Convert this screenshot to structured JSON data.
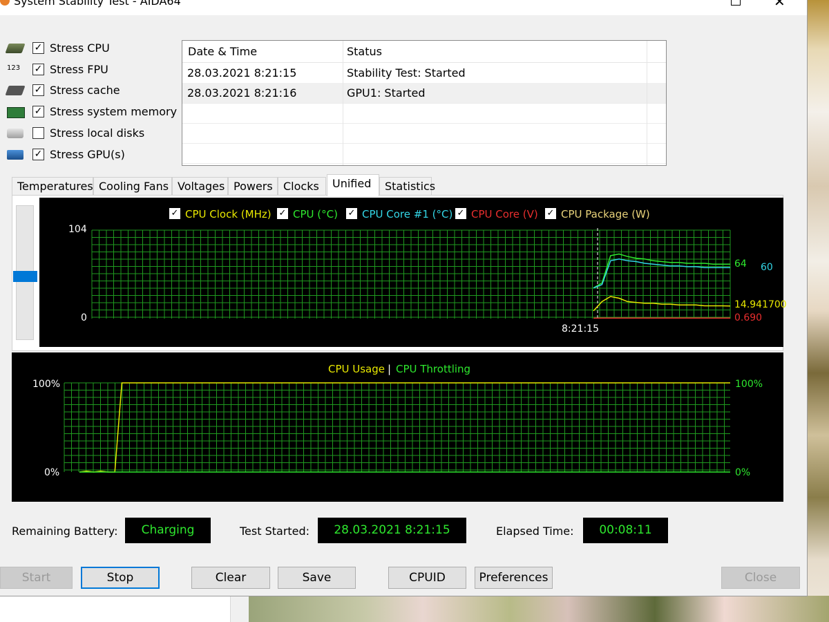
{
  "window": {
    "title": "System Stability Test - AIDA64"
  },
  "stress_options": [
    {
      "label": "Stress CPU",
      "checked": true,
      "icon": "cpu-chip-icon"
    },
    {
      "label": "Stress FPU",
      "checked": true,
      "icon": "fpu-123-icon"
    },
    {
      "label": "Stress cache",
      "checked": true,
      "icon": "cache-chip-icon"
    },
    {
      "label": "Stress system memory",
      "checked": true,
      "icon": "memory-module-icon"
    },
    {
      "label": "Stress local disks",
      "checked": false,
      "icon": "disk-drive-icon"
    },
    {
      "label": "Stress GPU(s)",
      "checked": true,
      "icon": "gpu-card-icon"
    }
  ],
  "checkmark": "✓",
  "log": {
    "headers": [
      "Date & Time",
      "Status"
    ],
    "rows": [
      [
        "28.03.2021 8:21:15",
        "Stability Test: Started"
      ],
      [
        "28.03.2021 8:21:16",
        "GPU1: Started"
      ]
    ]
  },
  "tabs": [
    "Temperatures",
    "Cooling Fans",
    "Voltages",
    "Powers",
    "Clocks",
    "Unified",
    "Statistics"
  ],
  "active_tab": "Unified",
  "slider": {
    "value_fraction": 0.53
  },
  "graph_top": {
    "legend": [
      {
        "label": "CPU Clock (MHz)",
        "color": "#e8e800"
      },
      {
        "label": "CPU (°C)",
        "color": "#2ee82e"
      },
      {
        "label": "CPU Core #1 (°C)",
        "color": "#33d6e6"
      },
      {
        "label": "CPU Core (V)",
        "color": "#e82e2e"
      },
      {
        "label": "CPU Package (W)",
        "color": "#e8d27a"
      }
    ],
    "y_max_label": "104",
    "y_min_label": "0",
    "x_label": "8:21:15",
    "right_values": [
      {
        "text": "64",
        "color": "#2ee82e"
      },
      {
        "text": "60",
        "color": "#33d6e6"
      },
      {
        "text": "14.941700",
        "color": "#e8e800"
      },
      {
        "text": "0.690",
        "color": "#e82e2e"
      }
    ]
  },
  "graph_bottom": {
    "legend": [
      {
        "label": "CPU Usage",
        "color": "#e8e800"
      },
      {
        "label": "|",
        "color": "#ffffff"
      },
      {
        "label": "CPU Throttling",
        "color": "#2ee82e"
      }
    ],
    "y_left_max": "100%",
    "y_left_min": "0%",
    "y_right_max": "100%",
    "y_right_min": "0%"
  },
  "chart_data": [
    {
      "type": "line",
      "legend": [
        "CPU Clock (MHz)",
        "CPU (°C)",
        "CPU Core #1 (°C)",
        "CPU Core (V)",
        "CPU Package (W)"
      ],
      "ylim": [
        0,
        104
      ],
      "x_tick_labels": [
        "8:21:15"
      ],
      "series": [
        {
          "name": "CPU (°C)",
          "color": "#2ee82e",
          "values": [
            36,
            42,
            74,
            76,
            73,
            71,
            70,
            68,
            67,
            66,
            66,
            65,
            65,
            65,
            64,
            64,
            64
          ]
        },
        {
          "name": "CPU Core #1 (°C)",
          "color": "#33d6e6",
          "values": [
            36,
            40,
            68,
            70,
            68,
            67,
            65,
            64,
            63,
            62,
            62,
            61,
            61,
            60,
            60,
            60,
            60
          ]
        },
        {
          "name": "CPU Package (W)",
          "color": "#e8e800",
          "values": [
            9,
            20,
            26,
            24,
            20,
            19,
            18,
            18,
            17,
            17,
            16,
            16,
            16,
            15,
            15,
            15,
            14.9
          ]
        },
        {
          "name": "CPU Core (V)",
          "color": "#e82e2e",
          "values": [
            0.6,
            0.7,
            0.7,
            0.7,
            0.7,
            0.7,
            0.7,
            0.7,
            0.7,
            0.7,
            0.7,
            0.7,
            0.69,
            0.69,
            0.69,
            0.69,
            0.69
          ]
        }
      ],
      "right_labels": [
        "64",
        "60",
        "14.941700",
        "0.690"
      ]
    },
    {
      "type": "line",
      "legend": [
        "CPU Usage",
        "CPU Throttling"
      ],
      "ylim": [
        0,
        100
      ],
      "series": [
        {
          "name": "CPU Usage",
          "color": "#e8e800",
          "values": [
            0,
            1,
            0,
            1,
            0,
            0,
            100,
            100,
            100,
            100,
            100,
            100,
            100,
            100,
            100,
            100,
            100,
            100,
            100,
            100,
            100,
            100,
            100,
            100,
            100,
            100,
            100,
            100,
            100,
            100,
            100,
            100,
            100,
            100,
            100,
            100,
            100,
            100,
            100,
            100,
            100,
            100,
            100,
            100,
            100,
            100,
            100,
            100,
            100,
            100,
            100,
            100,
            100,
            100,
            100,
            100,
            100,
            100,
            100,
            100,
            100,
            100,
            100,
            100,
            100,
            100,
            100,
            100,
            100,
            100,
            100,
            100,
            100,
            100,
            100,
            100,
            100,
            100,
            100,
            100,
            100,
            100,
            100,
            100,
            100,
            100,
            100,
            100,
            100,
            100,
            100,
            100,
            100
          ]
        },
        {
          "name": "CPU Throttling",
          "color": "#2ee82e",
          "values": [
            0,
            0
          ]
        }
      ]
    }
  ],
  "status": {
    "battery_label": "Remaining Battery:",
    "battery_value": "Charging",
    "started_label": "Test Started:",
    "started_value": "28.03.2021 8:21:15",
    "elapsed_label": "Elapsed Time:",
    "elapsed_value": "00:08:11"
  },
  "buttons": {
    "start": "Start",
    "stop": "Stop",
    "clear": "Clear",
    "save": "Save",
    "cpuid": "CPUID",
    "preferences": "Preferences",
    "close": "Close"
  }
}
